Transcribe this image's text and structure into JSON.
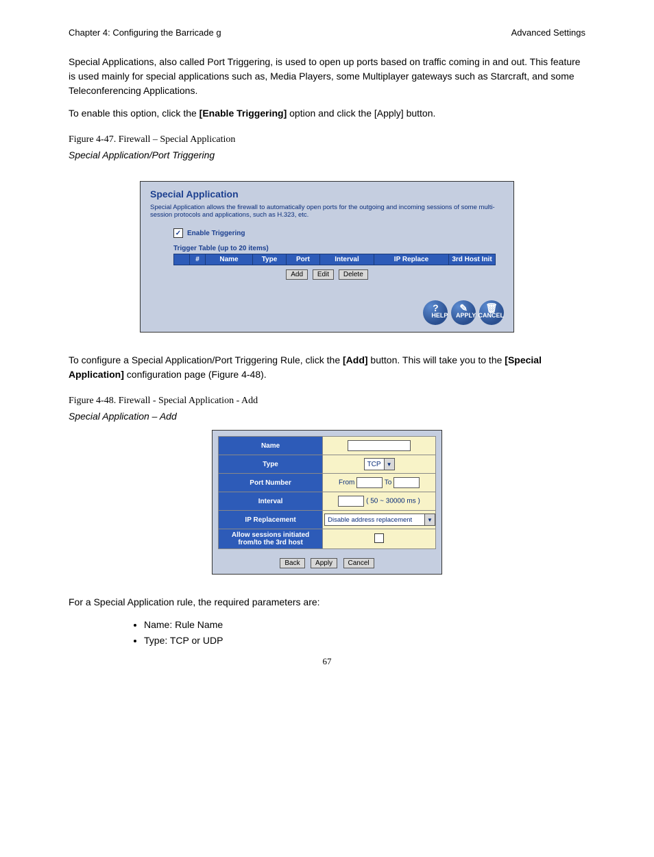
{
  "page": {
    "header_left": "Chapter 4: Configuring the Barricade g",
    "header_right": "Advanced Settings",
    "intro1": "Special Applications, also called Port Triggering, is used to open up ports based on traffic coming in and out. This feature is used mainly for special applications such as, Media Players, some Multiplayer gateways such as Starcraft, and some Teleconferencing Applications.",
    "intro2_a": "To enable this option, click the ",
    "intro2_bold": "[Enable Triggering]",
    "intro2_c": " option and click the [Apply] button.",
    "fig1_caption": "Figure 4-47. Firewall – Special Application",
    "fig1_italic": "Special Application/Port Triggering",
    "post1_a": "To configure a Special Application/Port Triggering Rule, click the ",
    "post1_bold": "[Add]",
    "post1_b": " button. This will take you to the ",
    "post1_bold2": "[Special Application]",
    "post1_c": " configuration page (Figure 4-48).",
    "fig2_caption": "Figure 4-48. Firewall - Special Application - Add",
    "fig2_italic": "Special Application – Add",
    "rule_intro": "For a Special Application rule, the required parameters are:",
    "bullets": [
      "Name: Rule Name",
      "Type: TCP or UDP"
    ],
    "page_number": "67"
  },
  "screenshot1": {
    "title": "Special Application",
    "desc": "Special Application allows the firewall to automatically open ports for the outgoing and incoming sessions of some multi-session protocols and applications, such as H.323, etc.",
    "cb_checked": "✓",
    "cb_label": "Enable Triggering",
    "table_caption": "Trigger Table (up to 20 items)",
    "cols": [
      "",
      "#",
      "Name",
      "Type",
      "Port",
      "Interval",
      "IP Replace",
      "3rd Host Init"
    ],
    "btn_add": "Add",
    "btn_edit": "Edit",
    "btn_delete": "Delete",
    "round_help": "HELP",
    "round_apply": "APPLY",
    "round_cancel": "CANCEL"
  },
  "screenshot2": {
    "rows": {
      "name_label": "Name",
      "type_label": "Type",
      "type_value": "TCP",
      "port_label": "Port Number",
      "port_from": "From",
      "port_to": "To",
      "interval_label": "Interval",
      "interval_hint": "( 50 ~ 30000 ms )",
      "iprepl_label": "IP Replacement",
      "iprepl_value": "Disable address replacement",
      "allow_label1": "Allow sessions initiated",
      "allow_label2": "from/to the 3rd host"
    },
    "btn_back": "Back",
    "btn_apply": "Apply",
    "btn_cancel": "Cancel"
  }
}
